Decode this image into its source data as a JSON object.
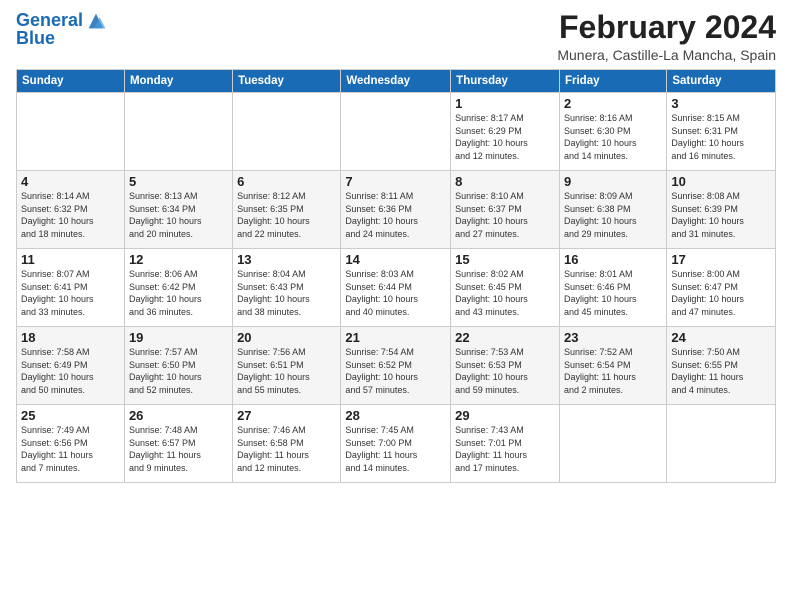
{
  "header": {
    "logo_line1": "General",
    "logo_line2": "Blue",
    "title": "February 2024",
    "subtitle": "Munera, Castille-La Mancha, Spain"
  },
  "weekdays": [
    "Sunday",
    "Monday",
    "Tuesday",
    "Wednesday",
    "Thursday",
    "Friday",
    "Saturday"
  ],
  "weeks": [
    [
      {
        "day": "",
        "info": ""
      },
      {
        "day": "",
        "info": ""
      },
      {
        "day": "",
        "info": ""
      },
      {
        "day": "",
        "info": ""
      },
      {
        "day": "1",
        "info": "Sunrise: 8:17 AM\nSunset: 6:29 PM\nDaylight: 10 hours\nand 12 minutes."
      },
      {
        "day": "2",
        "info": "Sunrise: 8:16 AM\nSunset: 6:30 PM\nDaylight: 10 hours\nand 14 minutes."
      },
      {
        "day": "3",
        "info": "Sunrise: 8:15 AM\nSunset: 6:31 PM\nDaylight: 10 hours\nand 16 minutes."
      }
    ],
    [
      {
        "day": "4",
        "info": "Sunrise: 8:14 AM\nSunset: 6:32 PM\nDaylight: 10 hours\nand 18 minutes."
      },
      {
        "day": "5",
        "info": "Sunrise: 8:13 AM\nSunset: 6:34 PM\nDaylight: 10 hours\nand 20 minutes."
      },
      {
        "day": "6",
        "info": "Sunrise: 8:12 AM\nSunset: 6:35 PM\nDaylight: 10 hours\nand 22 minutes."
      },
      {
        "day": "7",
        "info": "Sunrise: 8:11 AM\nSunset: 6:36 PM\nDaylight: 10 hours\nand 24 minutes."
      },
      {
        "day": "8",
        "info": "Sunrise: 8:10 AM\nSunset: 6:37 PM\nDaylight: 10 hours\nand 27 minutes."
      },
      {
        "day": "9",
        "info": "Sunrise: 8:09 AM\nSunset: 6:38 PM\nDaylight: 10 hours\nand 29 minutes."
      },
      {
        "day": "10",
        "info": "Sunrise: 8:08 AM\nSunset: 6:39 PM\nDaylight: 10 hours\nand 31 minutes."
      }
    ],
    [
      {
        "day": "11",
        "info": "Sunrise: 8:07 AM\nSunset: 6:41 PM\nDaylight: 10 hours\nand 33 minutes."
      },
      {
        "day": "12",
        "info": "Sunrise: 8:06 AM\nSunset: 6:42 PM\nDaylight: 10 hours\nand 36 minutes."
      },
      {
        "day": "13",
        "info": "Sunrise: 8:04 AM\nSunset: 6:43 PM\nDaylight: 10 hours\nand 38 minutes."
      },
      {
        "day": "14",
        "info": "Sunrise: 8:03 AM\nSunset: 6:44 PM\nDaylight: 10 hours\nand 40 minutes."
      },
      {
        "day": "15",
        "info": "Sunrise: 8:02 AM\nSunset: 6:45 PM\nDaylight: 10 hours\nand 43 minutes."
      },
      {
        "day": "16",
        "info": "Sunrise: 8:01 AM\nSunset: 6:46 PM\nDaylight: 10 hours\nand 45 minutes."
      },
      {
        "day": "17",
        "info": "Sunrise: 8:00 AM\nSunset: 6:47 PM\nDaylight: 10 hours\nand 47 minutes."
      }
    ],
    [
      {
        "day": "18",
        "info": "Sunrise: 7:58 AM\nSunset: 6:49 PM\nDaylight: 10 hours\nand 50 minutes."
      },
      {
        "day": "19",
        "info": "Sunrise: 7:57 AM\nSunset: 6:50 PM\nDaylight: 10 hours\nand 52 minutes."
      },
      {
        "day": "20",
        "info": "Sunrise: 7:56 AM\nSunset: 6:51 PM\nDaylight: 10 hours\nand 55 minutes."
      },
      {
        "day": "21",
        "info": "Sunrise: 7:54 AM\nSunset: 6:52 PM\nDaylight: 10 hours\nand 57 minutes."
      },
      {
        "day": "22",
        "info": "Sunrise: 7:53 AM\nSunset: 6:53 PM\nDaylight: 10 hours\nand 59 minutes."
      },
      {
        "day": "23",
        "info": "Sunrise: 7:52 AM\nSunset: 6:54 PM\nDaylight: 11 hours\nand 2 minutes."
      },
      {
        "day": "24",
        "info": "Sunrise: 7:50 AM\nSunset: 6:55 PM\nDaylight: 11 hours\nand 4 minutes."
      }
    ],
    [
      {
        "day": "25",
        "info": "Sunrise: 7:49 AM\nSunset: 6:56 PM\nDaylight: 11 hours\nand 7 minutes."
      },
      {
        "day": "26",
        "info": "Sunrise: 7:48 AM\nSunset: 6:57 PM\nDaylight: 11 hours\nand 9 minutes."
      },
      {
        "day": "27",
        "info": "Sunrise: 7:46 AM\nSunset: 6:58 PM\nDaylight: 11 hours\nand 12 minutes."
      },
      {
        "day": "28",
        "info": "Sunrise: 7:45 AM\nSunset: 7:00 PM\nDaylight: 11 hours\nand 14 minutes."
      },
      {
        "day": "29",
        "info": "Sunrise: 7:43 AM\nSunset: 7:01 PM\nDaylight: 11 hours\nand 17 minutes."
      },
      {
        "day": "",
        "info": ""
      },
      {
        "day": "",
        "info": ""
      }
    ]
  ]
}
